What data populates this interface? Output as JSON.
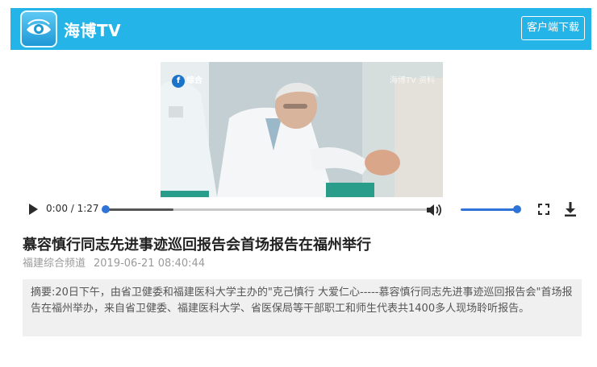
{
  "header": {
    "brand": "海博TV",
    "download_button": "客户端下载"
  },
  "video": {
    "channel_logo": "综合",
    "watermark": "海博TV 资料"
  },
  "player": {
    "time": "0:00 / 1:27",
    "progress_fraction": 0.0,
    "buffered_fraction": 0.21,
    "volume_fraction": 1.0,
    "icons": [
      "play-icon",
      "volume-icon",
      "fullscreen-icon",
      "download-icon"
    ]
  },
  "article": {
    "title": "慕容慎行同志先进事迹巡回报告会首场报告在福州举行",
    "channel": "福建综合频道",
    "datetime": "2019-06-21 08:40:44",
    "summary": "摘要:20日下午，由省卫健委和福建医科大学主办的\"克己慎行 大爱仁心-----慕容慎行同志先进事迹巡回报告会\"首场报告在福州举办，来自省卫健委、福建医科大学、省医保局等干部职工和师生代表共1400多人现场聆听报告。"
  },
  "colors": {
    "header_bg": "#25b4e8",
    "accent": "#2e73d8",
    "summary_bg": "#f0f0f0"
  }
}
